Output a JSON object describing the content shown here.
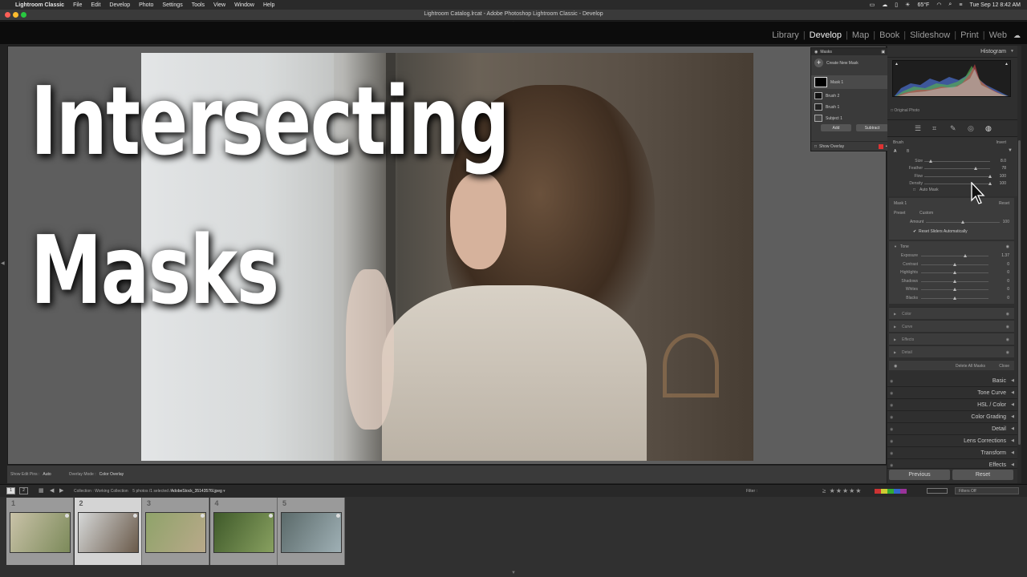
{
  "menubar": {
    "app_name": "Lightroom Classic",
    "items": [
      "File",
      "Edit",
      "Develop",
      "Photo",
      "Settings",
      "Tools",
      "View",
      "Window",
      "Help"
    ],
    "weather": "65°F",
    "datetime": "Tue Sep 12  8:42 AM"
  },
  "window": {
    "title": "Lightroom Catalog.lrcat - Adobe Photoshop Lightroom Classic - Develop"
  },
  "modules": {
    "items": [
      "Library",
      "Develop",
      "Map",
      "Book",
      "Slideshow",
      "Print",
      "Web"
    ],
    "active": "Develop"
  },
  "overlay": {
    "line1": "Intersecting",
    "line2": "Masks"
  },
  "masks_panel": {
    "title": "Masks",
    "create_new": "Create New Mask",
    "mask1": "Mask 1",
    "brush2": "Brush 2",
    "brush1": "Brush 1",
    "subject1": "Subject 1",
    "add": "Add",
    "subtract": "Subtract",
    "show_overlay": "Show Overlay"
  },
  "view_toolbar": {
    "show_edit_pins_label": "Show Edit Pins :",
    "show_edit_pins_value": "Auto",
    "overlay_mode_label": "Overlay Mode :",
    "overlay_mode_value": "Color Overlay"
  },
  "right_panel": {
    "histogram": "Histogram",
    "original_photo": "Original Photo",
    "brush": {
      "title": "Brush",
      "invert": "Invert",
      "a": "A",
      "b": "B",
      "sliders": [
        {
          "name": "Size",
          "value": "8.0",
          "pos": 0.1
        },
        {
          "name": "Feather",
          "value": "78",
          "pos": 0.78
        },
        {
          "name": "Flow",
          "value": "100",
          "pos": 1.0
        },
        {
          "name": "Density",
          "value": "100",
          "pos": 1.0
        }
      ],
      "auto_mask": "Auto Mask"
    },
    "mask": {
      "title": "Mask 1",
      "reset": "Reset",
      "preset_label": "Preset",
      "preset_value": "Custom",
      "amount_label": "Amount",
      "amount_value": "100",
      "amount_pos": 0.5,
      "reset_sliders": "Reset Sliders Automatically"
    },
    "tone": {
      "title": "Tone",
      "sliders": [
        {
          "name": "Exposure",
          "value": "1.37",
          "pos": 0.66
        },
        {
          "name": "Contrast",
          "value": "0",
          "pos": 0.5
        },
        {
          "name": "Highlights",
          "value": "0",
          "pos": 0.5
        },
        {
          "name": "Shadows",
          "value": "0",
          "pos": 0.5
        },
        {
          "name": "Whites",
          "value": "0",
          "pos": 0.5
        },
        {
          "name": "Blacks",
          "value": "0",
          "pos": 0.5
        }
      ]
    },
    "collapsed_sections": [
      "Color",
      "Curve",
      "Effects",
      "Detail"
    ],
    "delete_all_masks": "Delete All Masks",
    "close": "Close",
    "main_sections": [
      "Basic",
      "Tone Curve",
      "HSL / Color",
      "Color Grading",
      "Detail",
      "Lens Corrections",
      "Transform",
      "Effects"
    ],
    "previous": "Previous",
    "reset": "Reset"
  },
  "filmstrip_bar": {
    "page1": "1",
    "page2": "2",
    "source": "Collection : Working Collection",
    "count": "5 photos /1 selected /",
    "filename": "AdobeStock_35143576l.jpeg",
    "filter_label": "Filter :",
    "filters_off": "Filters Off"
  },
  "filmstrip": {
    "thumbs": [
      {
        "num": "1",
        "colors": [
          "#c9c2a8",
          "#7c8a5a"
        ]
      },
      {
        "num": "2",
        "colors": [
          "#d5d7d7",
          "#6a5a4a"
        ]
      },
      {
        "num": "3",
        "colors": [
          "#8fa36a",
          "#b9a98a"
        ]
      },
      {
        "num": "4",
        "colors": [
          "#3f5a2a",
          "#88a060"
        ]
      },
      {
        "num": "5",
        "colors": [
          "#5b6a6a",
          "#9fb0b5"
        ]
      }
    ],
    "selected_index": 1
  },
  "colors": {
    "accent_active": "#f0f0f0",
    "overlay_swatch": "#dd3333"
  }
}
